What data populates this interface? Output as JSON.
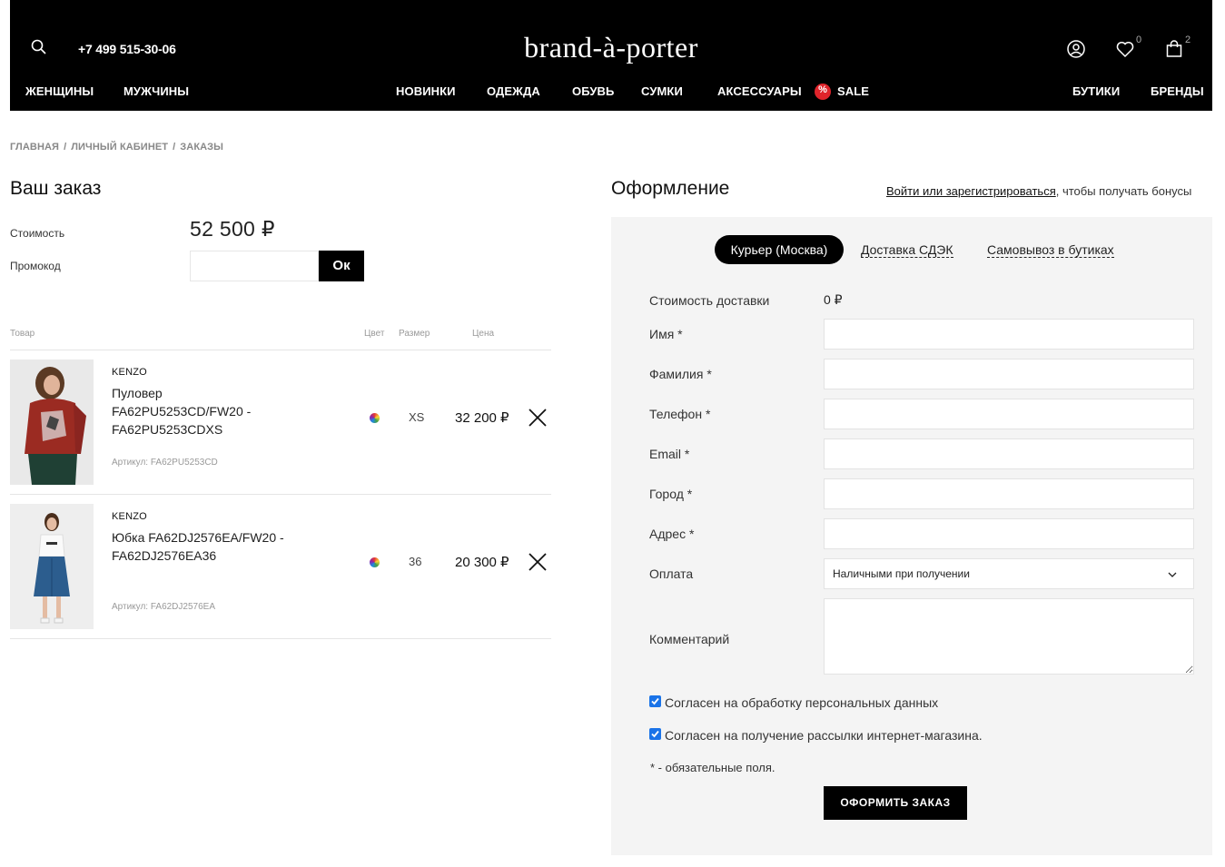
{
  "header": {
    "phone": "+7 499 515-30-06",
    "logo": "brand-à-porter",
    "wishlist_count": "0",
    "cart_count": "2",
    "nav_left": [
      "ЖЕНЩИНЫ",
      "МУЖЧИНЫ"
    ],
    "nav_center": [
      "НОВИНКИ",
      "ОДЕЖДА",
      "ОБУВЬ",
      "СУМКИ",
      "АКСЕССУАРЫ"
    ],
    "sale": "SALE",
    "nav_right": [
      "БУТИКИ",
      "БРЕНДЫ"
    ]
  },
  "breadcrumb": [
    "ГЛАВНАЯ",
    "ЛИЧНЫЙ КАБИНЕТ",
    "ЗАКАЗЫ"
  ],
  "order": {
    "title": "Ваш заказ",
    "cost_label": "Стоимость",
    "cost_value": "52 500 ₽",
    "promo_label": "Промокод",
    "promo_placeholder": "",
    "promo_button": "Ок",
    "columns": {
      "product": "Товар",
      "color": "Цвет",
      "size": "Размер",
      "price": "Цена"
    },
    "items": [
      {
        "brand": "KENZO",
        "name": "Пуловер FA62PU5253CD/FW20 - FA62PU5253CDXS",
        "article": "Артикул: FA62PU5253CD",
        "size": "XS",
        "price": "32 200 ₽"
      },
      {
        "brand": "KENZO",
        "name": "Юбка FA62DJ2576EA/FW20 - FA62DJ2576EA36",
        "article": "Артикул: FA62DJ2576EA",
        "size": "36",
        "price": "20 300 ₽"
      }
    ]
  },
  "checkout": {
    "title": "Оформление",
    "login_link": "Войти или зарегистрироваться",
    "login_suffix": ", чтобы получать бонусы",
    "tabs": [
      "Курьер (Москва)",
      "Доставка СДЭК",
      "Самовывоз в бутиках"
    ],
    "delivery_label": "Стоимость доставки",
    "delivery_value": "0 ₽",
    "fields": [
      "Имя *",
      "Фамилия *",
      "Телефон *",
      "Email *",
      "Город *",
      "Адрес *"
    ],
    "payment_label": "Оплата",
    "payment_value": "Наличными при получении",
    "comment_label": "Комментарий",
    "consent_personal": "Согласен на обработку персональных данных",
    "consent_newsletter": "Согласен на получение рассылки интернет-магазина.",
    "required_note": "* - обязательные поля.",
    "submit": "ОФОРМИТЬ ЗАКАЗ"
  }
}
